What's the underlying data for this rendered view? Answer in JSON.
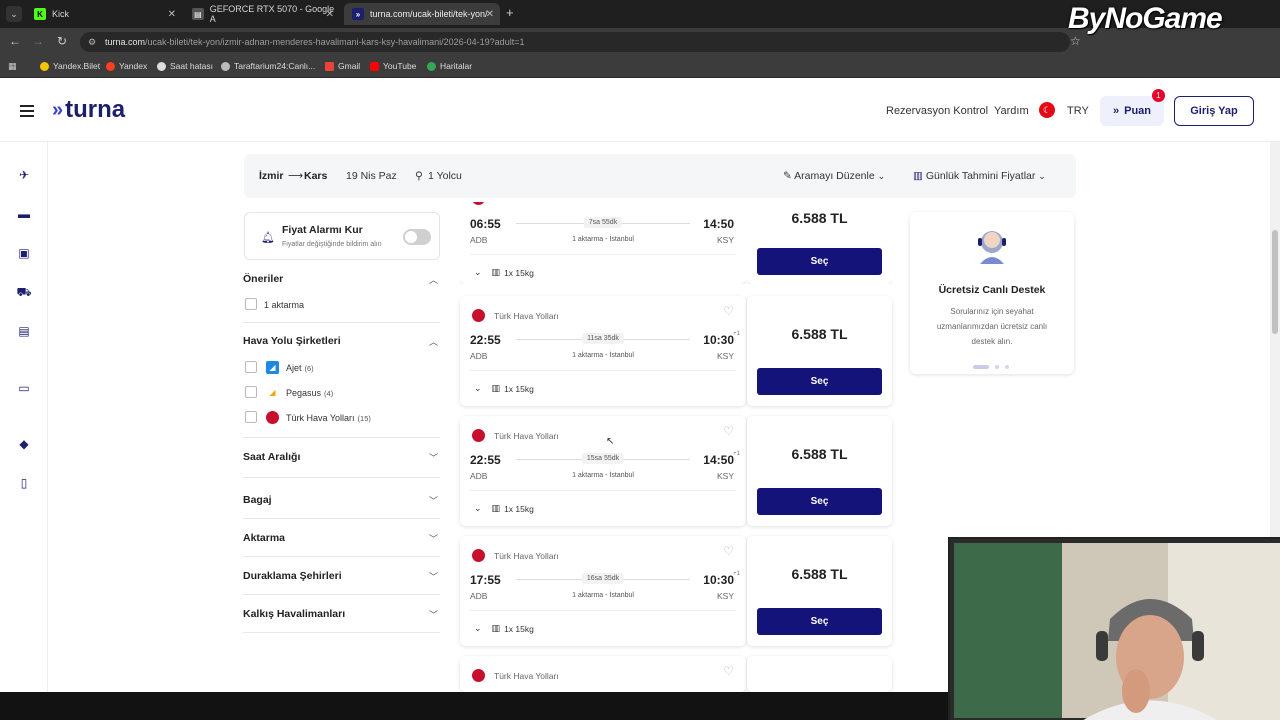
{
  "browser": {
    "tabs": [
      {
        "title": "Kick",
        "favicon_color": "#53fc18"
      },
      {
        "title": "GEFORCE RTX 5070 - Google A",
        "favicon_color": "#555555"
      },
      {
        "title": "turna.com/ucak-bileti/tek-yon/",
        "favicon_color": "#1b1f6e"
      }
    ],
    "new_tab": "+",
    "url_host": "turna.com",
    "url_path": "/ucak-bileti/tek-yon/izmir-adnan-menderes-havalimani-kars-ksy-havalimani/2026-04-19?adult=1",
    "bookmarks": [
      "Yandex.Bilet",
      "Yandex",
      "Saat hatası",
      "Taraftarium24:Canlı...",
      "Gmail",
      "YouTube",
      "Haritalar"
    ],
    "overlay_logo": "ByNoGame"
  },
  "header": {
    "brand": "turna",
    "links": [
      "Rezervasyon Kontrol",
      "Yardım"
    ],
    "currency": "TRY",
    "puan_label": "Puan",
    "puan_badge": "1",
    "login_label": "Giriş Yap"
  },
  "rail_icons": [
    "plane-icon",
    "bed-icon",
    "bus-icon",
    "car-icon",
    "train-icon",
    "card-icon",
    "tag-icon",
    "phone-icon"
  ],
  "summary": {
    "from": "İzmir",
    "to": "Kars",
    "date": "19 Nis Paz",
    "passengers": "1 Yolcu",
    "edit_label": "Aramayı Düzenle",
    "daily_prices_label": "Günlük Tahmini Fiyatlar"
  },
  "filters": {
    "alarm_title": "Fiyat Alarmı Kur",
    "alarm_sub": "Fiyatlar değiştiğinde bildirim alın",
    "suggestions_title": "Öneriler",
    "suggestions": [
      {
        "label": "1 aktarma"
      }
    ],
    "airlines_title": "Hava Yolu Şirketleri",
    "airlines": [
      {
        "label": "Ajet",
        "count": "(6)"
      },
      {
        "label": "Pegasus",
        "count": "(4)"
      },
      {
        "label": "Türk Hava Yolları",
        "count": "(15)"
      }
    ],
    "collapsed": [
      "Saat Aralığı",
      "Bagaj",
      "Aktarma",
      "Duraklama Şehirleri",
      "Kalkış Havalimanları"
    ]
  },
  "flights": [
    {
      "airline": "",
      "dep": "06:55",
      "arr": "14:50",
      "next_day": "",
      "duration": "7sa 55dk",
      "stops": "1 aktarma - İstanbul",
      "from": "ADB",
      "to": "KSY",
      "baggage": "1x 15kg",
      "price": "6.588 TL",
      "button": "Seç"
    },
    {
      "airline": "Türk Hava Yolları",
      "dep": "22:55",
      "arr": "10:30",
      "next_day": "+1",
      "duration": "11sa 35dk",
      "stops": "1 aktarma - İstanbul",
      "from": "ADB",
      "to": "KSY",
      "baggage": "1x 15kg",
      "price": "6.588 TL",
      "button": "Seç"
    },
    {
      "airline": "Türk Hava Yolları",
      "dep": "22:55",
      "arr": "14:50",
      "next_day": "+1",
      "duration": "15sa 55dk",
      "stops": "1 aktarma - İstanbul",
      "from": "ADB",
      "to": "KSY",
      "baggage": "1x 15kg",
      "price": "6.588 TL",
      "button": "Seç"
    },
    {
      "airline": "Türk Hava Yolları",
      "dep": "17:55",
      "arr": "10:30",
      "next_day": "+1",
      "duration": "16sa 35dk",
      "stops": "1 aktarma - İstanbul",
      "from": "ADB",
      "to": "KSY",
      "baggage": "1x 15kg",
      "price": "6.588 TL",
      "button": "Seç"
    },
    {
      "airline": "Türk Hava Yolları"
    }
  ],
  "support": {
    "title": "Ücretsiz Canlı Destek",
    "text": "Sorularınız için seyahat uzmanlarımızdan ücretsiz canlı destek alın."
  },
  "colors": {
    "brand_navy": "#1b1f6e",
    "button_navy": "#14137a",
    "thy_red": "#c8102e"
  }
}
